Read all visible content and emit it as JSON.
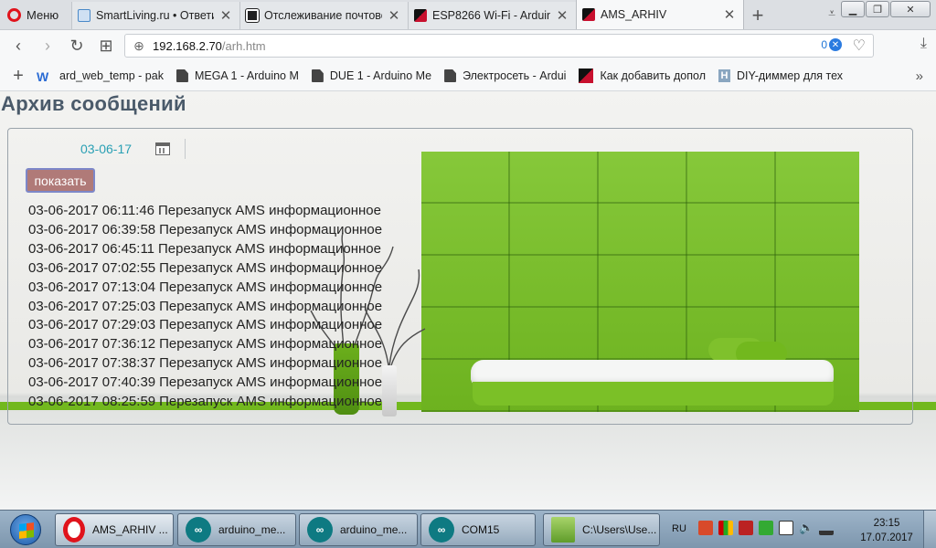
{
  "browser": {
    "menu_label": "Меню",
    "tabs": [
      {
        "title": "SmartLiving.ru • Ответит",
        "favicon_color": "#4a89c8"
      },
      {
        "title": "Отслеживание почтово",
        "favicon_color": "#222222"
      },
      {
        "title": "ESP8266 Wi-Fi - Arduino",
        "favicon_color": "#c8102e"
      },
      {
        "title": "AMS_ARHIV",
        "favicon_color": "#c8102e"
      }
    ],
    "active_tab_index": 3,
    "url_host": "192.168.2.70",
    "url_path": "/arh.htm",
    "adblock_count": "0",
    "bookmarks": [
      {
        "label": "ard_web_temp - pak"
      },
      {
        "label": "MEGA 1 - Arduino M"
      },
      {
        "label": "DUE 1 - Arduino Me"
      },
      {
        "label": "Электросеть - Ardui"
      },
      {
        "label": "Как добавить допол"
      },
      {
        "label": "DIY-диммер для тех"
      }
    ]
  },
  "page": {
    "title": "Архив сообщений",
    "date_value": "03-06-17",
    "show_button": "показать",
    "log": [
      {
        "date": "03-06-2017",
        "time": "06:11:46",
        "message": "Перезапуск AMS информационное"
      },
      {
        "date": "03-06-2017",
        "time": "06:39:58",
        "message": "Перезапуск AMS информационное"
      },
      {
        "date": "03-06-2017",
        "time": "06:45:11",
        "message": "Перезапуск AMS информационное"
      },
      {
        "date": "03-06-2017",
        "time": "07:02:55",
        "message": "Перезапуск AMS информационное"
      },
      {
        "date": "03-06-2017",
        "time": "07:13:04",
        "message": "Перезапуск AMS информационное"
      },
      {
        "date": "03-06-2017",
        "time": "07:25:03",
        "message": "Перезапуск AMS информационное"
      },
      {
        "date": "03-06-2017",
        "time": "07:29:03",
        "message": "Перезапуск AMS информационное"
      },
      {
        "date": "03-06-2017",
        "time": "07:36:12",
        "message": "Перезапуск AMS информационное"
      },
      {
        "date": "03-06-2017",
        "time": "07:38:37",
        "message": "Перезапуск AMS информационное"
      },
      {
        "date": "03-06-2017",
        "time": "07:40:39",
        "message": "Перезапуск AMS информационное"
      },
      {
        "date": "03-06-2017",
        "time": "08:25:59",
        "message": "Перезапуск AMS информационное"
      }
    ]
  },
  "taskbar": {
    "tasks": [
      {
        "label": "AMS_ARHIV ...",
        "icon": "opera-icon"
      },
      {
        "label": "arduino_me...",
        "icon": "arduino-icon"
      },
      {
        "label": "arduino_me...",
        "icon": "arduino-icon"
      },
      {
        "label": "COM15",
        "icon": "arduino-icon"
      },
      {
        "label": "C:\\Users\\Use...",
        "icon": "notepad-icon"
      }
    ],
    "language": "RU",
    "time": "23:15",
    "date": "17.07.2017"
  }
}
